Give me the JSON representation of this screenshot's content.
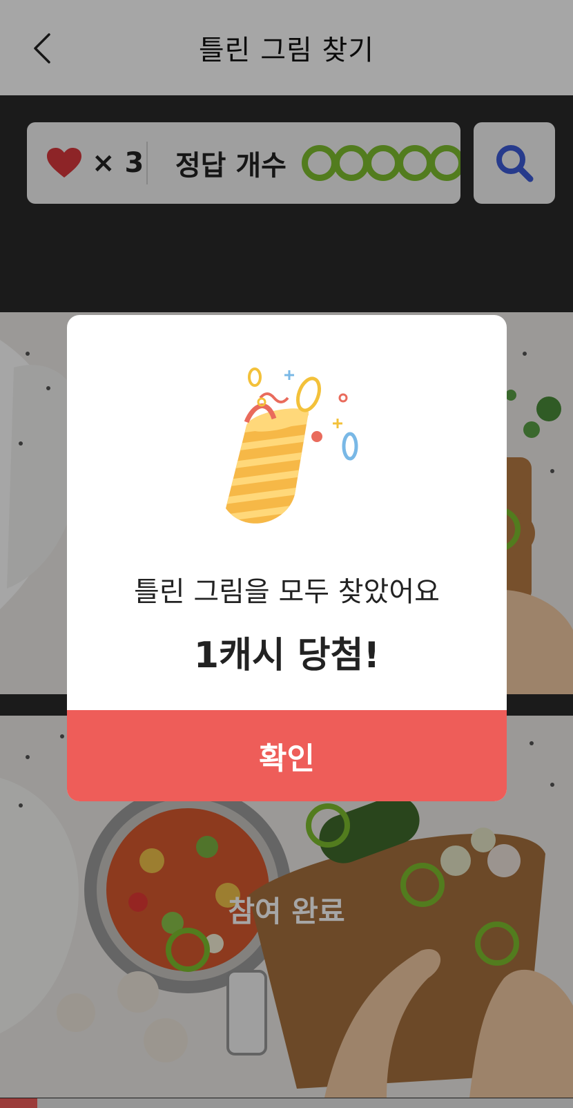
{
  "header": {
    "title": "틀린 그림 찾기"
  },
  "status": {
    "lives_text": "× 3",
    "answer_label": "정답 개수",
    "answer_circles": 5
  },
  "game": {
    "participation_text": "참여 완료",
    "progress_percent": 6.5
  },
  "modal": {
    "message": "틀린 그림을 모두 찾았어요",
    "reward": "1캐시 당첨!",
    "confirm_label": "확인"
  },
  "colors": {
    "accent": "#ee5d59",
    "marker": "#7fbf2f",
    "hint": "#3d5bd8",
    "heart": "#d9383c"
  }
}
